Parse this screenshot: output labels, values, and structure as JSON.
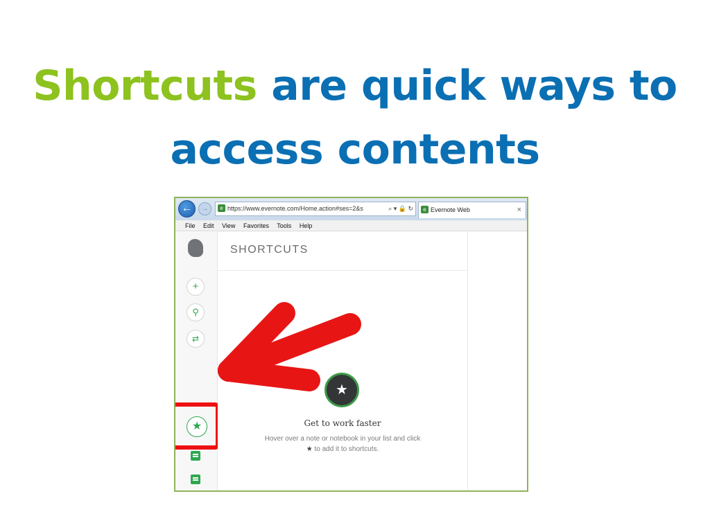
{
  "slide": {
    "title_accent": "Shortcuts",
    "title_rest": " are quick ways to",
    "title_line2": "access contents"
  },
  "browser": {
    "url": "https://www.evernote.com/Home.action#ses=2&s",
    "tab_title": "Evernote Web",
    "close_glyph": "×",
    "menu": [
      "File",
      "Edit",
      "View",
      "Favorites",
      "Tools",
      "Help"
    ]
  },
  "evernote": {
    "panel_title": "SHORTCUTS",
    "empty_title": "Get to work faster",
    "empty_desc_line1": "Hover over a note or notebook in your list and click",
    "empty_desc_line2": "to add it to shortcuts.",
    "star_glyph": "★",
    "plus_glyph": "+",
    "search_glyph": "⚲"
  },
  "colors": {
    "accent_green": "#8dc21f",
    "title_blue": "#0b6fb3",
    "highlight_red": "#ee1111",
    "evernote_green": "#2ea84f"
  }
}
